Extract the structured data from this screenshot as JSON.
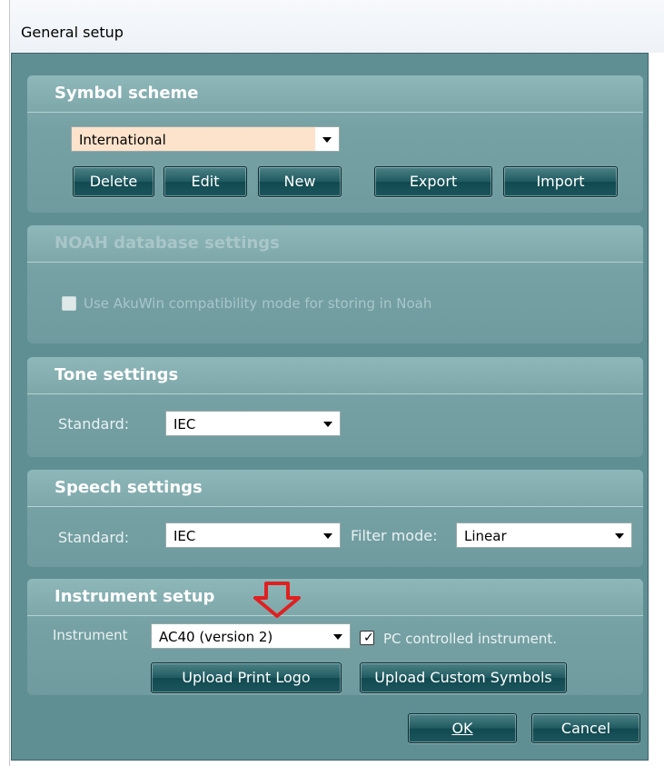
{
  "window": {
    "title": "General setup"
  },
  "symbol_scheme": {
    "title": "Symbol scheme",
    "selected": "International",
    "buttons": {
      "delete": "Delete",
      "edit": "Edit",
      "new": "New",
      "export": "Export",
      "import": "Import"
    }
  },
  "noah": {
    "title": "NOAH database settings",
    "checkbox_label": "Use AkuWin compatibility mode for storing in Noah",
    "checked": false
  },
  "tone": {
    "title": "Tone settings",
    "standard_label": "Standard:",
    "standard_value": "IEC"
  },
  "speech": {
    "title": "Speech settings",
    "standard_label": "Standard:",
    "standard_value": "IEC",
    "filter_label": "Filter mode:",
    "filter_value": "Linear"
  },
  "instrument": {
    "title": "Instrument setup",
    "instrument_label": "Instrument",
    "instrument_value": "AC40 (version 2)",
    "pc_controlled_label": "PC controlled instrument.",
    "pc_controlled": true,
    "upload_logo": "Upload Print Logo",
    "upload_symbols": "Upload Custom Symbols"
  },
  "footer": {
    "ok": "OK",
    "cancel": "Cancel"
  },
  "colors": {
    "panel": "#76a1a4",
    "client": "#5f8f93",
    "button": "#1f5a60",
    "arrow": "#e02020"
  },
  "annotation": {
    "icon": "red-down-arrow-icon"
  }
}
